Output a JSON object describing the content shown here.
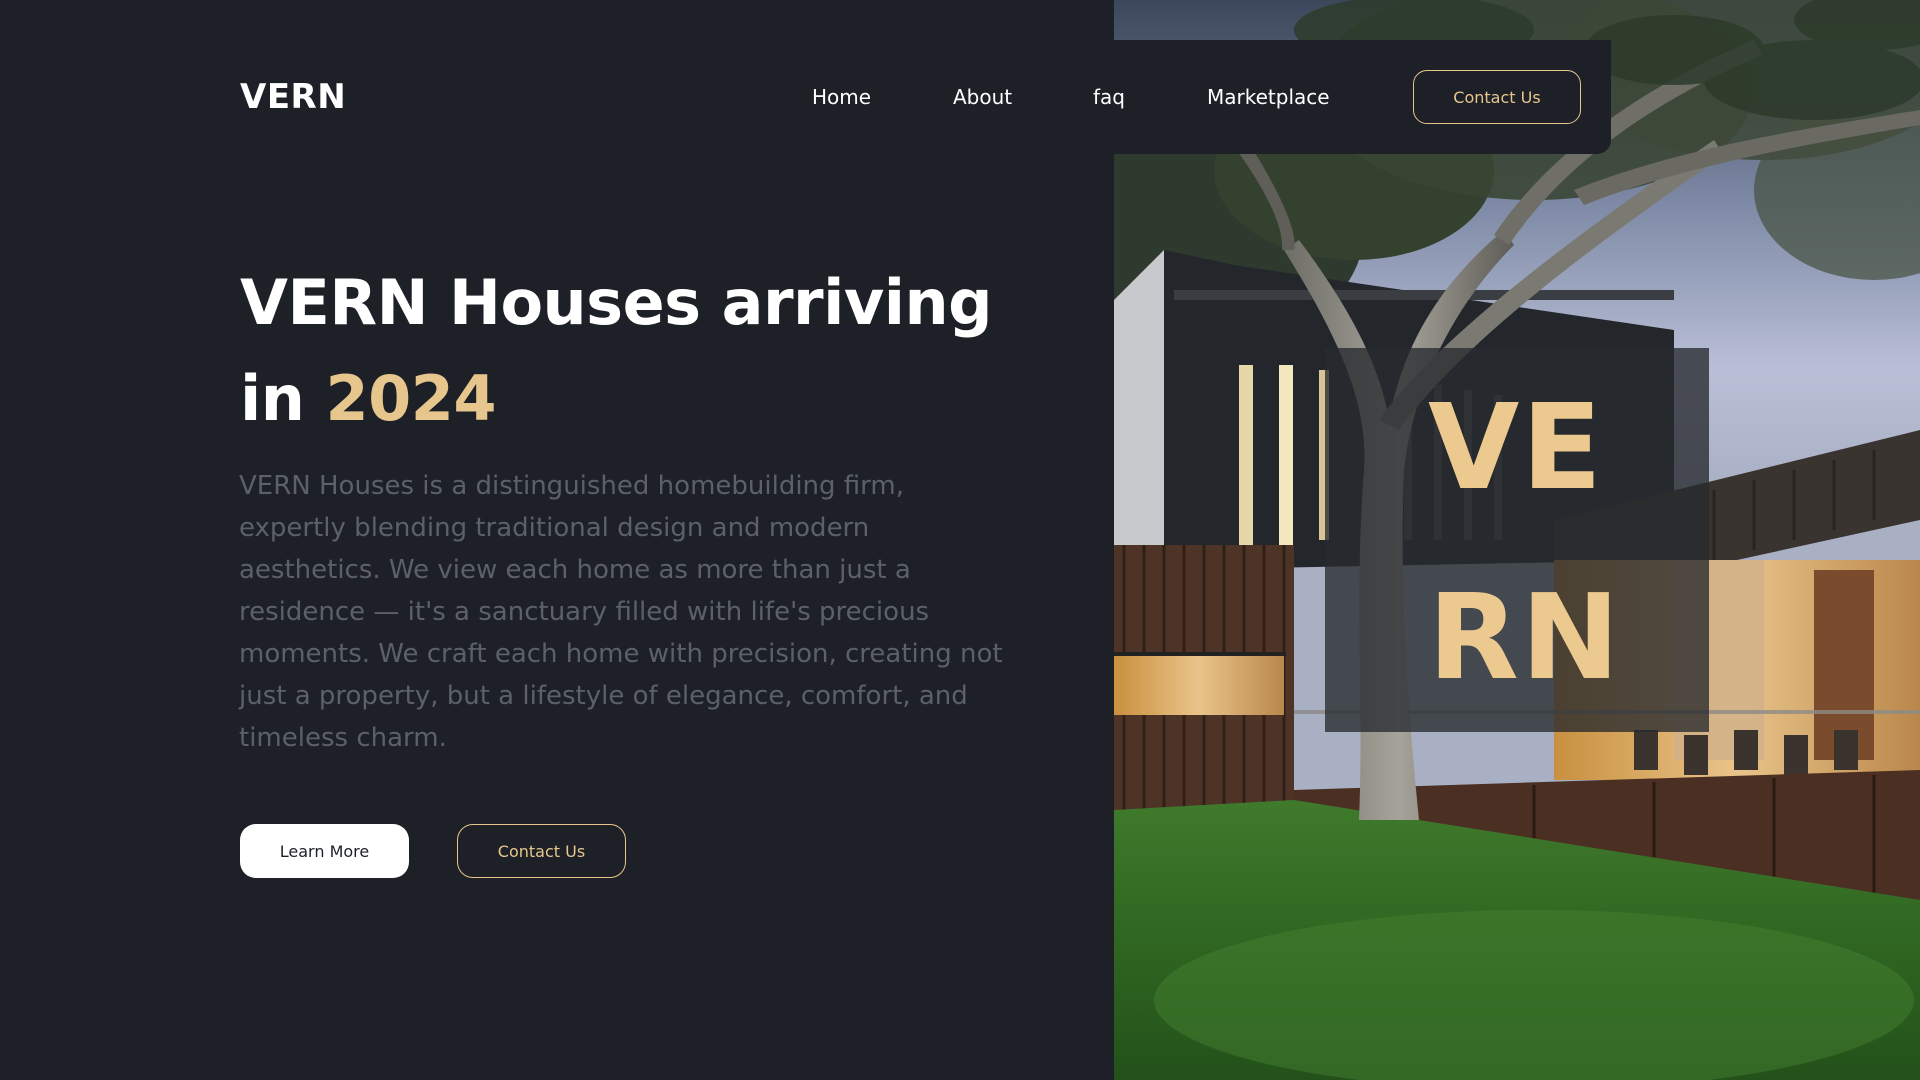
{
  "brand": {
    "logo": "VERN"
  },
  "nav": {
    "items": [
      {
        "label": "Home"
      },
      {
        "label": "About"
      },
      {
        "label": "faq"
      },
      {
        "label": "Marketplace"
      }
    ],
    "cta_label": "Contact Us"
  },
  "hero": {
    "headline_part1": "VERN Houses arriving",
    "headline_in": "in",
    "headline_year": "2024",
    "description": "VERN Houses is a distinguished homebuilding firm, expertly blending traditional design and modern aesthetics. We view each home as more than just a residence — it's a sanctuary filled with life's precious moments. We craft each home with precision, creating not just a property, but a lifestyle of elegance, comfort, and timeless charm.",
    "learn_more_label": "Learn More",
    "contact_label": "Contact Us"
  },
  "overlay": {
    "line1": "VE",
    "line2": "RN"
  },
  "colors": {
    "background": "#1d2027",
    "accent": "#e7c68d",
    "text_primary": "#ffffff",
    "text_muted": "#5b606b"
  }
}
